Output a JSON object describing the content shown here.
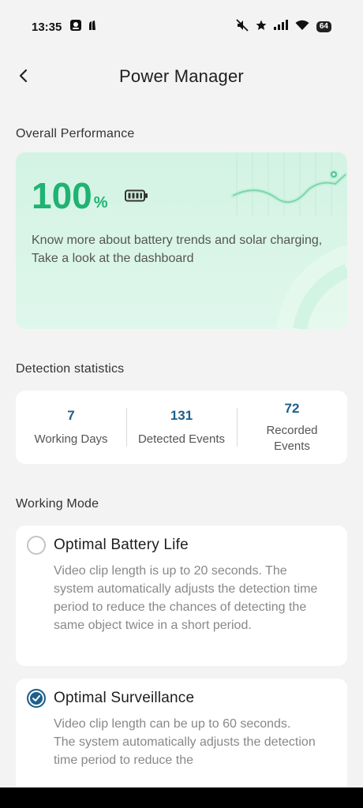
{
  "status_bar": {
    "time": "13:35",
    "battery_level": "64",
    "icons": [
      "notification-app-icon",
      "notification-extra-icon",
      "mute-icon",
      "star-icon",
      "signal-icon",
      "wifi-icon",
      "battery-icon"
    ]
  },
  "header": {
    "title": "Power Manager",
    "back_icon": "chevron-left-icon"
  },
  "overall": {
    "section_label": "Overall Performance",
    "value": "100",
    "unit": "%",
    "battery_icon": "battery-full-icon",
    "description": "Know more about battery trends and solar charging, Take a look at the dashboard",
    "accent_color": "#1fb373",
    "card_color": "#d8f5e8"
  },
  "detection": {
    "section_label": "Detection statistics",
    "stats": [
      {
        "value": "7",
        "label": "Working Days"
      },
      {
        "value": "131",
        "label": "Detected Events"
      },
      {
        "value": "72",
        "label": "Recorded Events"
      }
    ],
    "value_color": "#1d5f8c"
  },
  "working_mode": {
    "section_label": "Working Mode",
    "modes": [
      {
        "title": "Optimal Battery Life",
        "selected": false,
        "description": "Video clip length is up to 20 seconds. The system automatically adjusts the detection time period to reduce the chances of detecting the same object twice in a short period."
      },
      {
        "title": "Optimal Surveillance",
        "selected": true,
        "description_line1": "Video clip length can be up to 60 seconds.",
        "description_line2": "The system automatically adjusts the detection time period to reduce the"
      }
    ],
    "selected_color": "#1d5f8c"
  }
}
